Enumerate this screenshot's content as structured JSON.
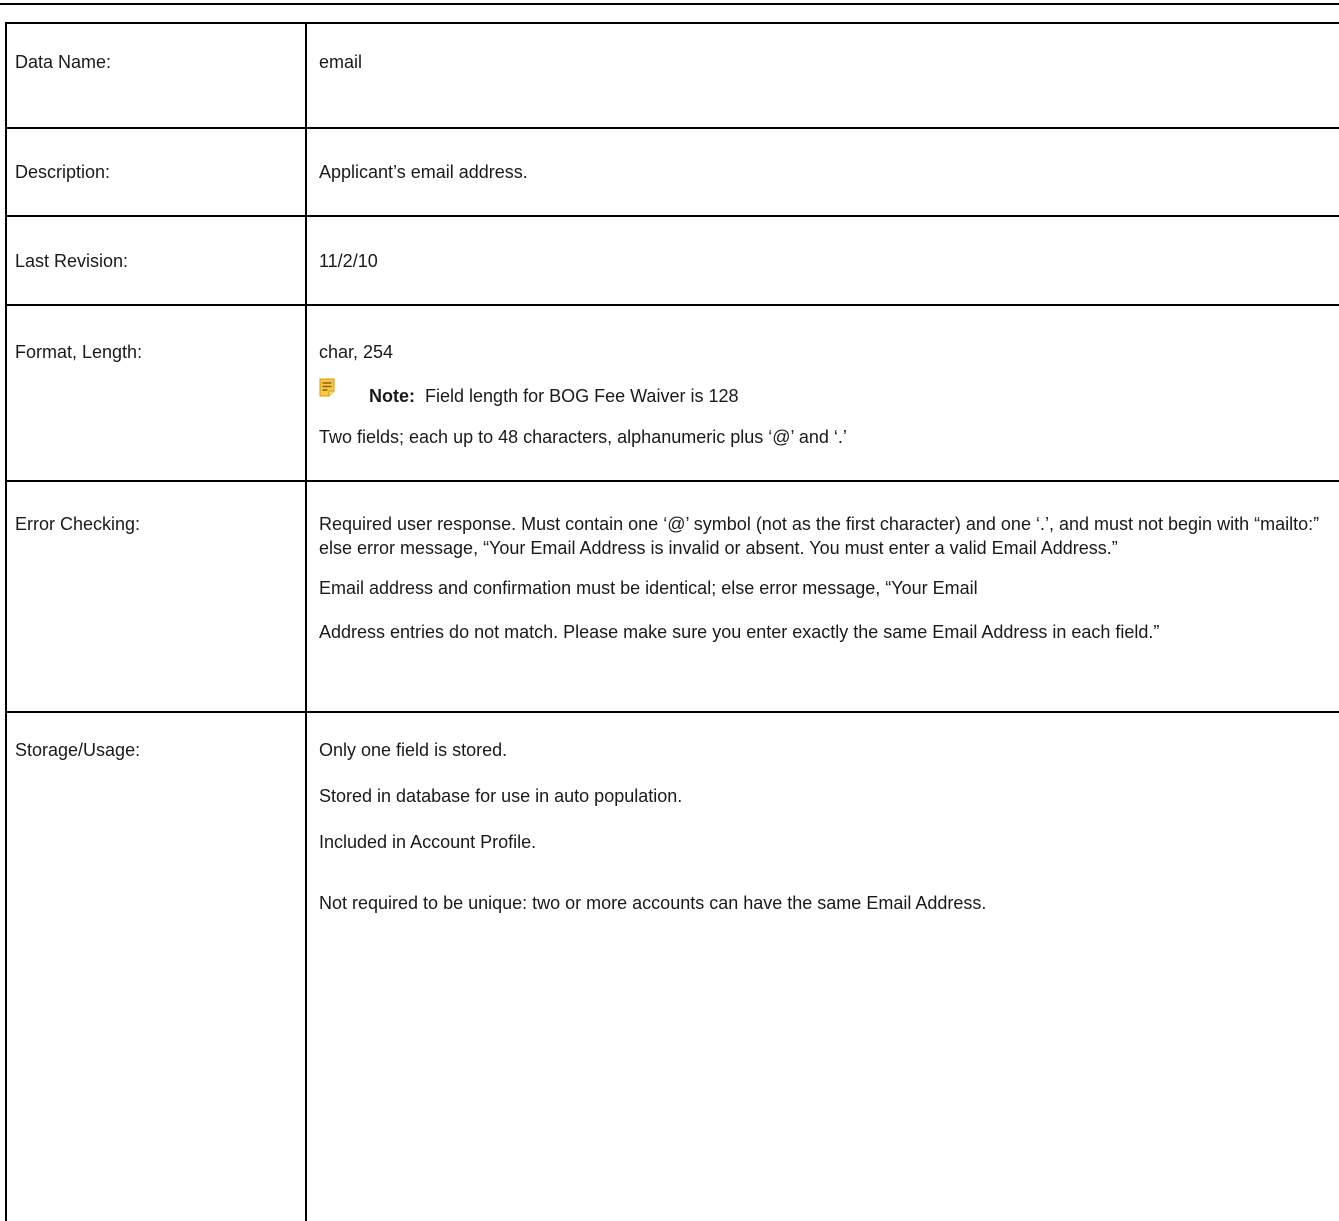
{
  "rows": {
    "data_name": {
      "label": "Data Name:",
      "value": "email"
    },
    "description": {
      "label": "Description:",
      "value": "Applicant’s email address."
    },
    "last_revision": {
      "label": "Last Revision:",
      "value": "11/2/10"
    },
    "format": {
      "label": "Format, Length:",
      "value": "char, 254",
      "note_label": "Note:",
      "note_text": "Field length for BOG Fee Waiver is 128",
      "detail": "Two fields; each up to 48 characters, alphanumeric plus ‘@’ and ‘.’"
    },
    "error_checking": {
      "label": "Error Checking:",
      "para1": "Required user response. Must contain one ‘@’ symbol (not as the first character) and one ‘.’, and must not begin with “mailto:” else error message, “Your Email Address is invalid or absent. You must enter a valid Email Address.”",
      "para2": "Email address and confirmation must be identical; else error message, “Your Email",
      "para3": "Address entries do not match. Please make sure you enter exactly the same Email Address in each field.”"
    },
    "storage": {
      "label": "Storage/Usage:",
      "p1": "Only one field is stored.",
      "p2": "Stored in database for use in auto population.",
      "p3": "Included in Account Profile.",
      "p4": "Not required to be unique: two or more accounts can have the same Email Address."
    }
  },
  "icons": {
    "note": "note-icon"
  },
  "colors": {
    "note_icon": "#f2b200",
    "border": "#000000"
  }
}
